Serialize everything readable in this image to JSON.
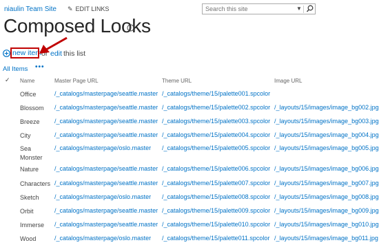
{
  "top_bar": {
    "site_title": "niaulin Team Site",
    "edit_links_label": "EDIT LINKS",
    "search_placeholder": "Search this site"
  },
  "page_title": "Composed Looks",
  "toolbar": {
    "new_item": "new item",
    "or_text": "or",
    "edit": "edit",
    "this_list": "this list"
  },
  "view": {
    "name": "All Items",
    "more": "•••"
  },
  "columns": [
    "Name",
    "Master Page URL",
    "Theme URL",
    "Image URL"
  ],
  "rows": [
    {
      "name": "Office",
      "master": "/_catalogs/masterpage/seattle.master",
      "theme": "/_catalogs/theme/15/palette001.spcolor",
      "image": ""
    },
    {
      "name": "Blossom",
      "master": "/_catalogs/masterpage/seattle.master",
      "theme": "/_catalogs/theme/15/palette002.spcolor",
      "image": "/_layouts/15/images/image_bg002.jpg"
    },
    {
      "name": "Breeze",
      "master": "/_catalogs/masterpage/seattle.master",
      "theme": "/_catalogs/theme/15/palette003.spcolor",
      "image": "/_layouts/15/images/image_bg003.jpg"
    },
    {
      "name": "City",
      "master": "/_catalogs/masterpage/seattle.master",
      "theme": "/_catalogs/theme/15/palette004.spcolor",
      "image": "/_layouts/15/images/image_bg004.jpg"
    },
    {
      "name": "Sea Monster",
      "master": "/_catalogs/masterpage/oslo.master",
      "theme": "/_catalogs/theme/15/palette005.spcolor",
      "image": "/_layouts/15/images/image_bg005.jpg"
    },
    {
      "name": "Nature",
      "master": "/_catalogs/masterpage/seattle.master",
      "theme": "/_catalogs/theme/15/palette006.spcolor",
      "image": "/_layouts/15/images/image_bg006.jpg"
    },
    {
      "name": "Characters",
      "master": "/_catalogs/masterpage/seattle.master",
      "theme": "/_catalogs/theme/15/palette007.spcolor",
      "image": "/_layouts/15/images/image_bg007.jpg"
    },
    {
      "name": "Sketch",
      "master": "/_catalogs/masterpage/oslo.master",
      "theme": "/_catalogs/theme/15/palette008.spcolor",
      "image": "/_layouts/15/images/image_bg008.jpg"
    },
    {
      "name": "Orbit",
      "master": "/_catalogs/masterpage/seattle.master",
      "theme": "/_catalogs/theme/15/palette009.spcolor",
      "image": "/_layouts/15/images/image_bg009.jpg"
    },
    {
      "name": "Immerse",
      "master": "/_catalogs/masterpage/seattle.master",
      "theme": "/_catalogs/theme/15/palette010.spcolor",
      "image": "/_layouts/15/images/image_bg010.jpg"
    },
    {
      "name": "Wood",
      "master": "/_catalogs/masterpage/oslo.master",
      "theme": "/_catalogs/theme/15/palette011.spcolor",
      "image": "/_layouts/15/images/image_bg011.jpg"
    }
  ],
  "colors": {
    "link": "#0072c6",
    "highlight_box": "#c00000",
    "title": "#262626"
  },
  "icons": {
    "edit_links": "pencil-icon",
    "search": "magnifier-icon",
    "info": "info-icon",
    "new_item": "plus-circle-icon",
    "annotation": "red-arrow"
  }
}
